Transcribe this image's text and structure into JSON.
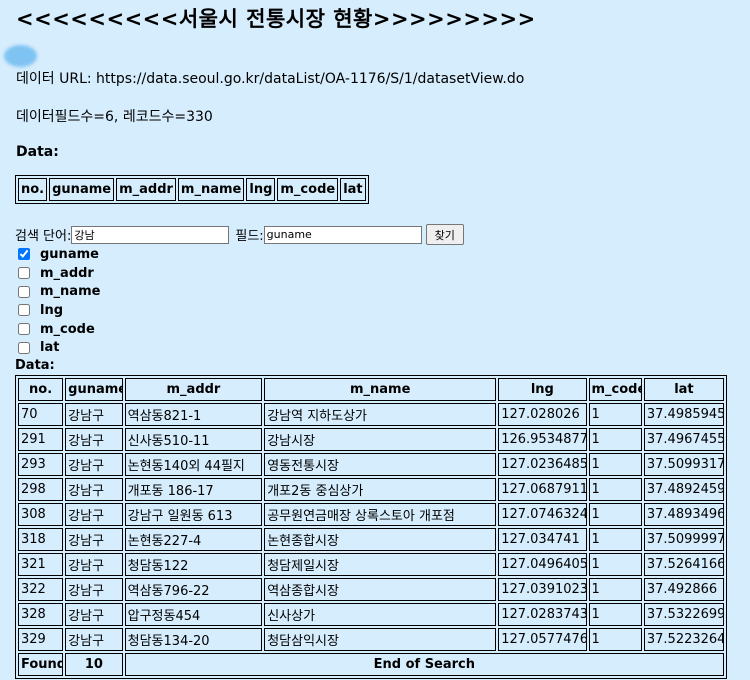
{
  "title": "<<<<<<<<<서울시 전통시장 현황>>>>>>>>>",
  "data_url_label": "데이터 URL: https://data.seoul.go.kr/dataList/OA-1176/S/1/datasetView.do",
  "counts_label": "데이터필드수=6, 레코드수=330",
  "data_label": "Data:",
  "fields": [
    "no.",
    "guname",
    "m_addr",
    "m_name",
    "lng",
    "m_code",
    "lat"
  ],
  "search": {
    "word_label": "검색 단어:",
    "word_value": "강남",
    "field_label": "필드:",
    "field_value": "guname",
    "button_label": "찾기"
  },
  "checkboxes": [
    {
      "label": "guname",
      "checked": true
    },
    {
      "label": "m_addr",
      "checked": false
    },
    {
      "label": "m_name",
      "checked": false
    },
    {
      "label": "lng",
      "checked": false
    },
    {
      "label": "m_code",
      "checked": false
    },
    {
      "label": "lat",
      "checked": false
    }
  ],
  "results_label": "Data:",
  "results": {
    "headers": [
      "no.",
      "guname",
      "m_addr",
      "m_name",
      "lng",
      "m_code",
      "lat"
    ],
    "rows": [
      [
        "70",
        "강남구",
        "역삼동821-1",
        "강남역 지하도상가",
        "127.028026",
        "1",
        "37.4985945"
      ],
      [
        "291",
        "강남구",
        "신사동510-11",
        "강남시장",
        "126.9534877",
        "1",
        "37.4967455"
      ],
      [
        "293",
        "강남구",
        "논현동140외 44필지",
        "영동전통시장",
        "127.0236485",
        "1",
        "37.5099317"
      ],
      [
        "298",
        "강남구",
        "개포동 186-17",
        "개포2동 중심상가",
        "127.0687911",
        "1",
        "37.4892459"
      ],
      [
        "308",
        "강남구",
        "강남구 일원동 613",
        "공무원연금매장 상록스토아 개포점",
        "127.0746324",
        "1",
        "37.4893496"
      ],
      [
        "318",
        "강남구",
        "논현동227-4",
        "논현종합시장",
        "127.034741",
        "1",
        "37.5099997"
      ],
      [
        "321",
        "강남구",
        "청담동122",
        "청담제일시장",
        "127.0496405",
        "1",
        "37.5264166"
      ],
      [
        "322",
        "강남구",
        "역삼동796-22",
        "역삼종합시장",
        "127.0391023",
        "1",
        "37.492866"
      ],
      [
        "328",
        "강남구",
        "압구정동454",
        "신사상가",
        "127.0283743",
        "1",
        "37.5322699"
      ],
      [
        "329",
        "강남구",
        "청담동134-20",
        "청담삼익시장",
        "127.0577476",
        "1",
        "37.5223264"
      ]
    ],
    "footer": {
      "found_label": "Found",
      "found_count": "10",
      "end_label": "End of Search"
    }
  }
}
